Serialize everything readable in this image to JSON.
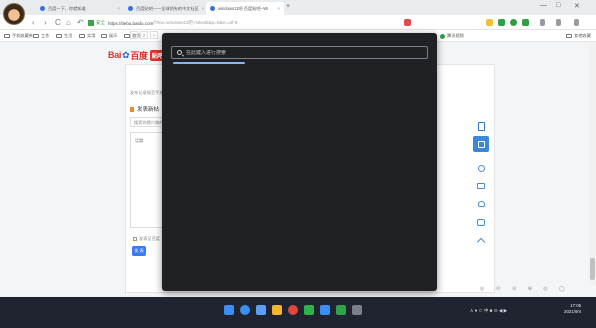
{
  "browser": {
    "tabs": [
      {
        "label": "百度一下，你就知道",
        "active": false
      },
      {
        "label": "百度贴吧——全球领先的中文社区",
        "active": false
      },
      {
        "label": "windows11吧 百度贴吧--Wi",
        "active": true
      }
    ],
    "tab_close": "×",
    "new_tab": "+",
    "window_controls": {
      "minimize": "—",
      "maximize": "□",
      "close": "✕"
    },
    "nav": {
      "back": "‹",
      "forward": "›",
      "refresh": "C",
      "home": "⌂",
      "undo": "↶"
    },
    "url": {
      "secure_label": "安全",
      "host": "https://tieba.baidu.com",
      "path": "/f?kw=windows11吧-riskedit&p=0&ie=utf-8"
    },
    "bookmarks": [
      {
        "label": "手机收藏夹"
      },
      {
        "label": "工作"
      },
      {
        "label": "生活"
      },
      {
        "label": "实用"
      },
      {
        "label": "娱乐"
      },
      {
        "label": "游戏"
      }
    ],
    "bookmark_extra": "腾讯视频",
    "bookmark_right": "其他收藏"
  },
  "page": {
    "logo": {
      "part1": "Bai",
      "part2": "百度",
      "badge": "贴吧"
    },
    "pager": [
      "<",
      "2",
      ">"
    ],
    "breadcrumb": "发布记录规范手册",
    "section_title": "发表新帖",
    "title_placeholder": "搜索你感兴趣的",
    "editor_toolbar": "话题",
    "anonymous_label": "发表至百度",
    "submit_label": "发 表",
    "sidebar_icons": [
      "document-icon",
      "edit-icon",
      "refresh-icon",
      "message-icon",
      "heart-icon",
      "chat-icon",
      "up-arrow-icon"
    ],
    "status_icons": "◎ ⓦ ⊙ ⊕ ◎ ◯"
  },
  "modal": {
    "search_placeholder": "在此键入进行搜索",
    "search_value": "",
    "progress": 0.28
  },
  "taskbar": {
    "icons": [
      "start-icon",
      "search-icon",
      "task-view-icon",
      "file-explorer-icon",
      "chrome-icon",
      "wechat-icon",
      "mail-icon",
      "photos-icon",
      "settings-icon"
    ],
    "tray": "∧ ● ⊂ 中 ■ ⊙ ◀ ▶",
    "time": "17:05",
    "date": "2021/9/4"
  }
}
